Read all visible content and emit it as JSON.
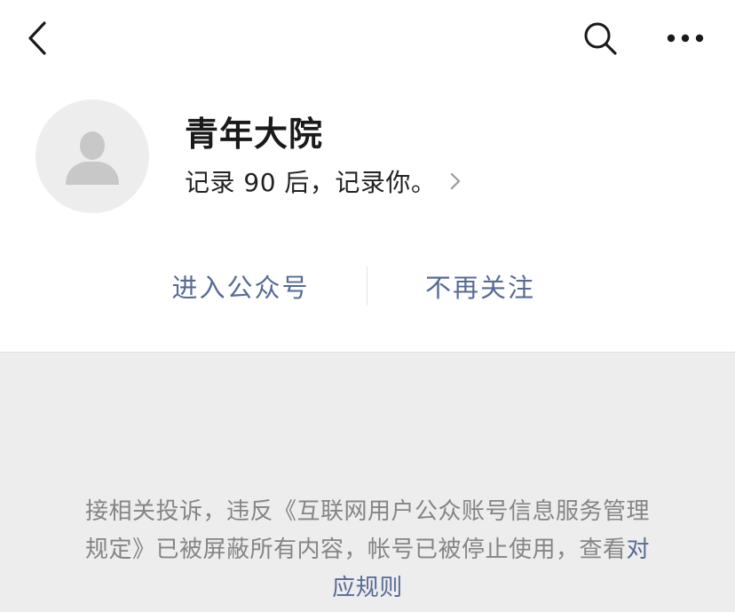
{
  "top_bar": {
    "back_icon": "chevron-left-icon",
    "search_icon": "search-icon",
    "more_icon": "more-horizontal-icon"
  },
  "profile": {
    "avatar_icon": "default-user-avatar-icon",
    "name": "青年大院",
    "bio": "记录 90 后，记录你。",
    "bio_chevron_icon": "chevron-right-icon"
  },
  "actions": {
    "enter_label": "进入公众号",
    "unfollow_label": "不再关注"
  },
  "notice": {
    "text": "接相关投诉，违反《互联网用户公众账号信息服务管理规定》已被屏蔽所有内容，帐号已被停止使用，查看",
    "link_label": "对应规则"
  },
  "colors": {
    "link": "#576b95",
    "notice_text": "#858585",
    "notice_background": "#ededed",
    "avatar_background": "#ededed",
    "avatar_silhouette": "#c8c8c8"
  }
}
